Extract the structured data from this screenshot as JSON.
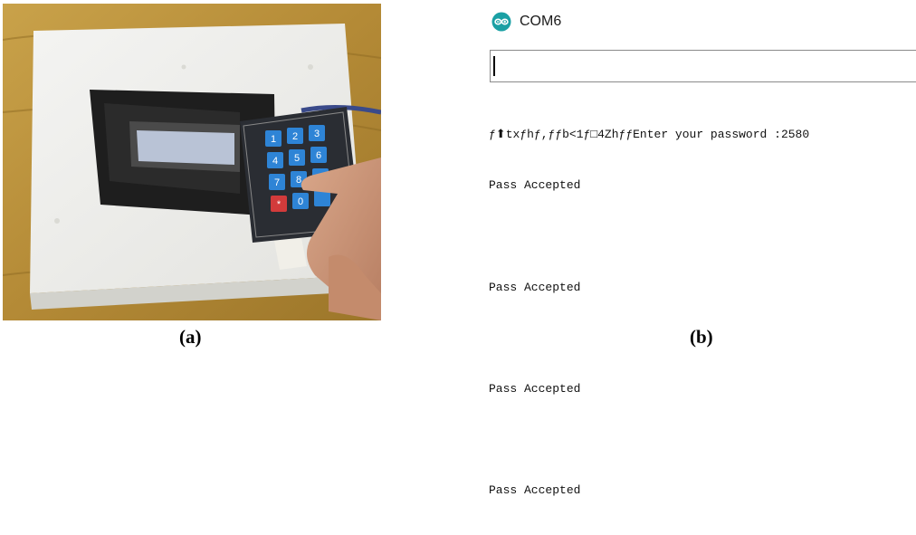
{
  "panel_a": {
    "caption": "(a)"
  },
  "panel_b": {
    "caption": "(b)",
    "window": {
      "title": "COM6",
      "icon": "arduino-infinity-icon",
      "icon_color": "#1aa0a4"
    },
    "send_input": {
      "value": "",
      "placeholder": ""
    },
    "output_lines": [
      "ƒ⬆txƒhƒ,ƒƒb<1ƒ□4ZhƒƒEnter your password :2580",
      "Pass Accepted",
      "",
      "Pass Accepted",
      "",
      "Pass Accepted",
      "",
      "Pass Accepted"
    ]
  }
}
